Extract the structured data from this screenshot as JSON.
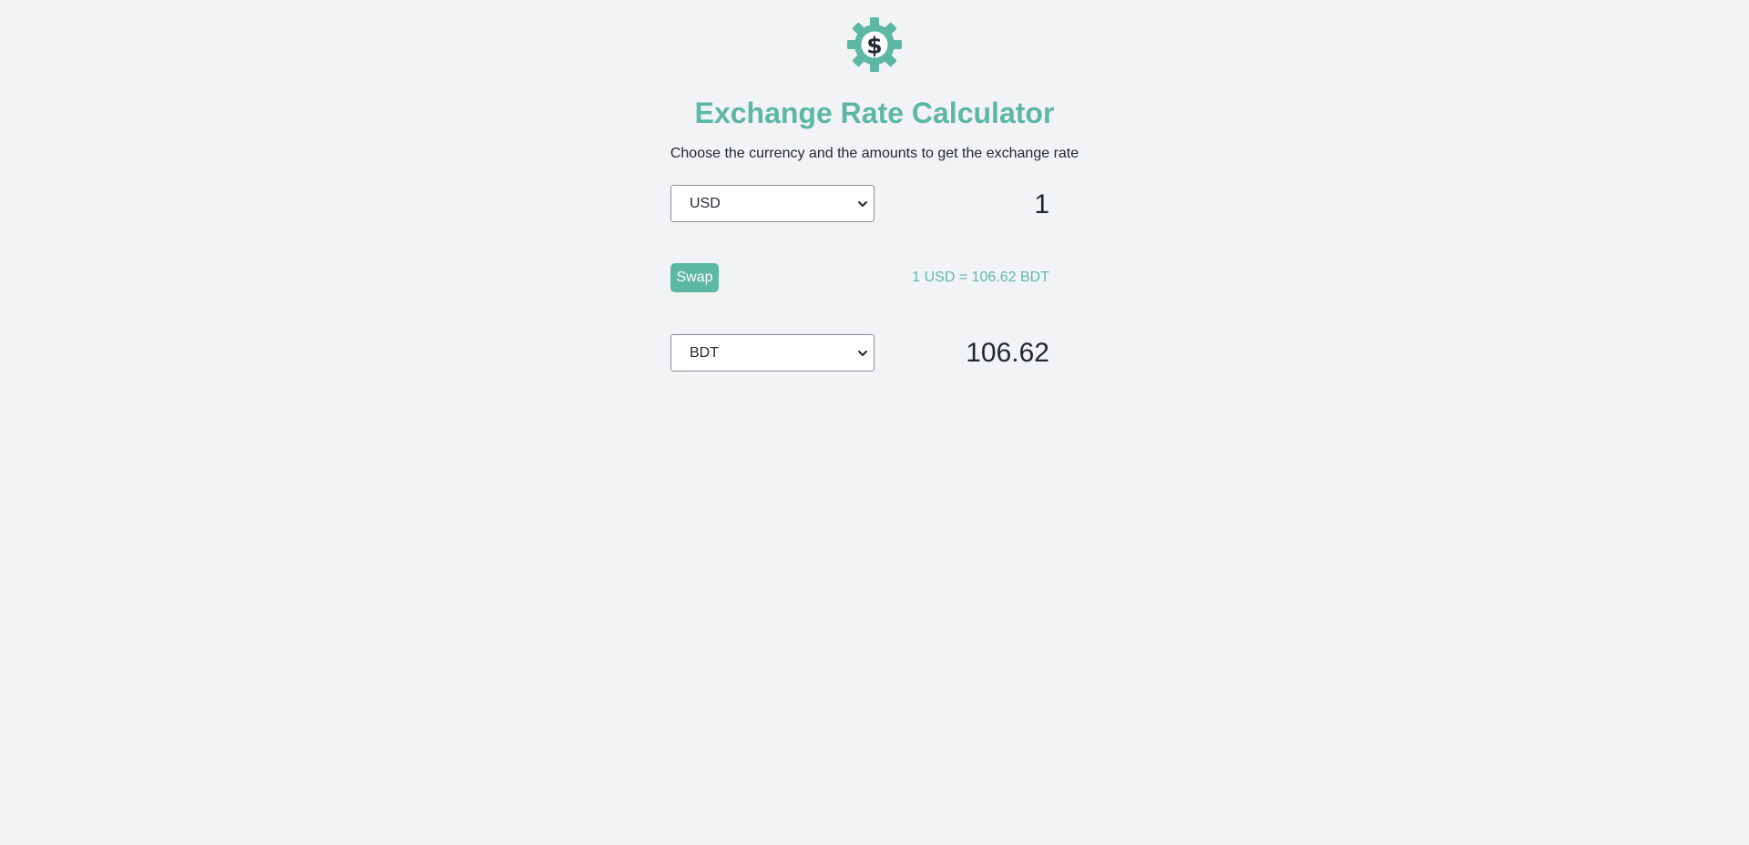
{
  "header": {
    "logo_icon": "dollar-gear-icon",
    "title": "Exchange Rate Calculator",
    "subtitle": "Choose the currency and the amounts to get the exchange rate"
  },
  "currency_one": {
    "selected": "USD",
    "amount": "1"
  },
  "swap": {
    "label": "Swap"
  },
  "rate": {
    "text": "1 USD = 106.62 BDT"
  },
  "currency_two": {
    "selected": "BDT",
    "amount": "106.62"
  },
  "colors": {
    "accent": "#5cb8a3",
    "background": "#f2f3f5",
    "text": "#222831"
  }
}
